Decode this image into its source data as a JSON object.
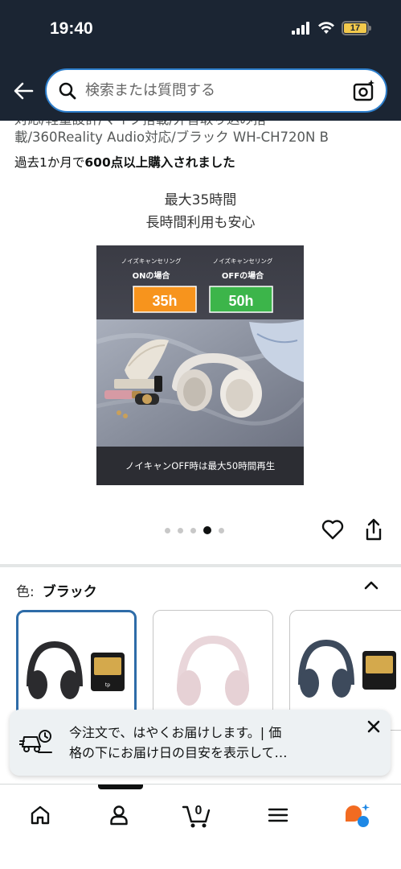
{
  "status_bar": {
    "time": "19:40",
    "battery": "17"
  },
  "search": {
    "placeholder": "検索または質問する"
  },
  "product": {
    "title_line1": "対応/軽量設計/マイク搭載/外音取り込み搭",
    "title_line2": "載/360Reality Audio対応/ブラック WH-CH720N B",
    "purchase_prefix": "過去1か月で",
    "purchase_bold": "600点以上購入されました",
    "caption_line1": "最大35時間",
    "caption_line2": "長時間利用も安心"
  },
  "image": {
    "nc_on_label": "ノイズキャンセリング",
    "nc_on_sub": "ONの場合",
    "nc_on_hours": "35h",
    "nc_off_label": "ノイズキャンセリング",
    "nc_off_sub": "OFFの場合",
    "nc_off_hours": "50h",
    "footer_text": "ノイキャンOFF時は最大50時間再生"
  },
  "carousel": {
    "count": 5,
    "active_index": 3
  },
  "color": {
    "label": "色:",
    "value": "ブラック",
    "variants": [
      "black",
      "pink",
      "blue"
    ]
  },
  "toast": {
    "line1": "今注文で、はやくお届けします。| 価",
    "line2": "格の下にお届け日の目安を表示して…"
  },
  "cart": {
    "count": "0"
  },
  "colors": {
    "header_bg": "#1b2533",
    "search_border": "#2d7ecb",
    "selected_variant_border": "#2e6ca8",
    "nc_on": "#f7941d",
    "nc_off": "#3cb54a",
    "rufus_orange": "#f26b21",
    "rufus_blue": "#1e88e5"
  }
}
